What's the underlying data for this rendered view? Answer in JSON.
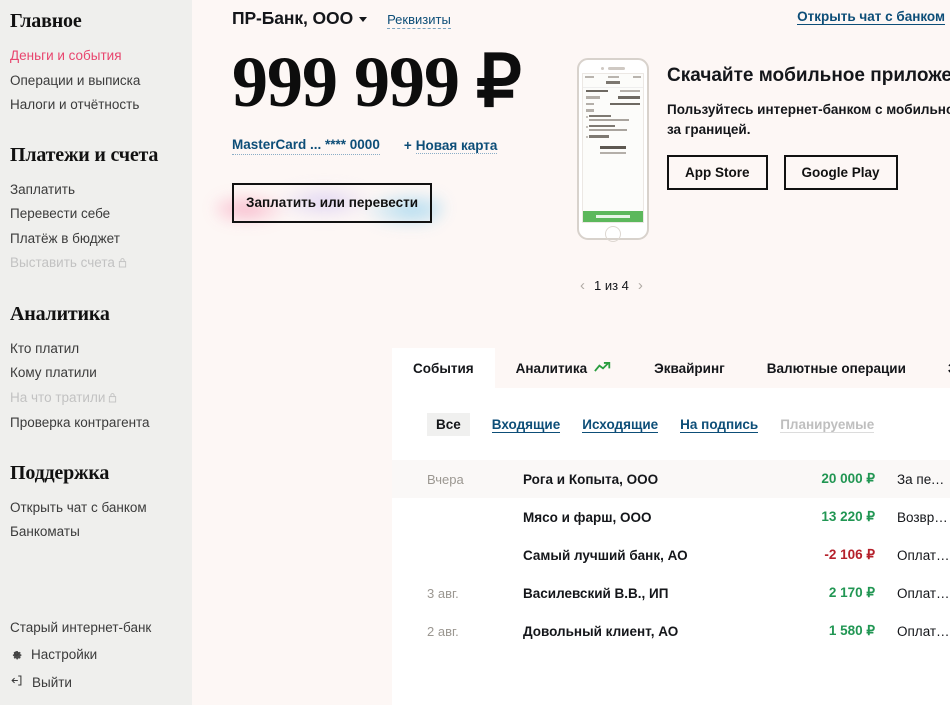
{
  "sidebar": {
    "sections": [
      {
        "title": "Главное",
        "items": [
          {
            "label": "Деньги и события",
            "state": "active"
          },
          {
            "label": "Операции и выписка",
            "state": "normal"
          },
          {
            "label": "Налоги и отчётность",
            "state": "normal"
          }
        ]
      },
      {
        "title": "Платежи и счета",
        "items": [
          {
            "label": "Заплатить",
            "state": "normal"
          },
          {
            "label": "Перевести себе",
            "state": "normal"
          },
          {
            "label": "Платёж в бюджет",
            "state": "normal"
          },
          {
            "label": "Выставить счета",
            "state": "locked"
          }
        ]
      },
      {
        "title": "Аналитика",
        "items": [
          {
            "label": "Кто платил",
            "state": "normal"
          },
          {
            "label": "Кому платили",
            "state": "normal"
          },
          {
            "label": "На что тратили",
            "state": "locked"
          },
          {
            "label": "Проверка контрагента",
            "state": "normal"
          }
        ]
      },
      {
        "title": "Поддержка",
        "items": [
          {
            "label": "Открыть чат с банком",
            "state": "normal"
          },
          {
            "label": "Банкоматы",
            "state": "normal"
          }
        ]
      }
    ],
    "bottom": {
      "old_bank": "Старый интернет-банк",
      "settings": "Настройки",
      "logout": "Выйти"
    }
  },
  "header": {
    "company": "ПР-Банк, ООО",
    "requisites_link": "Реквизиты",
    "chat_link": "Открыть чат с банком"
  },
  "account": {
    "balance": "999 999 ₽",
    "card_label": "MasterCard ...  **** 0000",
    "new_card_label": "Новая карта",
    "new_card_plus": "+",
    "pay_button": "Заплатить или перевести"
  },
  "promo": {
    "heading": "Скачайте мобильное приложение",
    "text": "Пользуйтесь интернет-банком с мобильного в пробках, на бегу или за границей.",
    "app_store": "App Store",
    "google_play": "Google Play",
    "carousel_prev": "‹",
    "carousel_next": "›",
    "carousel_counter": "1 из 4"
  },
  "tabs": [
    {
      "label": "События",
      "active": true,
      "icon": null
    },
    {
      "label": "Аналитика",
      "active": false,
      "icon": "trend-up-icon"
    },
    {
      "label": "Эквайринг",
      "active": false,
      "icon": null
    },
    {
      "label": "Валютные операции",
      "active": false,
      "icon": null
    },
    {
      "label": "Зарплатный проект",
      "active": false,
      "icon": null
    }
  ],
  "filters": [
    {
      "label": "Все",
      "state": "selected"
    },
    {
      "label": "Входящие",
      "state": "link"
    },
    {
      "label": "Исходящие",
      "state": "link"
    },
    {
      "label": "На подпись",
      "state": "link"
    },
    {
      "label": "Планируемые",
      "state": "disabled"
    }
  ],
  "transactions": [
    {
      "date": "Вчера",
      "name": "Рога и Копыта, ООО",
      "amount": "20 000 ₽",
      "sign": "pos",
      "desc": "За печеньки по счету. БЕЗ НДС",
      "shade": true
    },
    {
      "date": "",
      "name": "Мясо и фарш, ООО",
      "amount": "13 220 ₽",
      "sign": "pos",
      "desc": "Возврат за поставки мяса по счету...",
      "shade": false
    },
    {
      "date": "",
      "name": "Самый лучший банк, АО",
      "amount": "-2 106 ₽",
      "sign": "neg",
      "desc": "Оплата за услуги эквайринга за II квар",
      "shade": false
    },
    {
      "date": "3 авг.",
      "name": "Василевский В.В., ИП",
      "amount": "2 170 ₽",
      "sign": "pos",
      "desc": "Оплата услуг за размещение новости",
      "shade": false
    },
    {
      "date": "2 авг.",
      "name": "Довольный клиент, АО",
      "amount": "1 580 ₽",
      "sign": "pos",
      "desc": "Оплата услуг по предоставлению рекл",
      "shade": false
    }
  ],
  "colors": {
    "accent_pink": "#e8456e",
    "link_blue": "#0d4e78",
    "positive_green": "#219653",
    "negative_red": "#b5202b",
    "sidebar_bg": "#efefed",
    "main_bg": "#fdf7f5"
  }
}
